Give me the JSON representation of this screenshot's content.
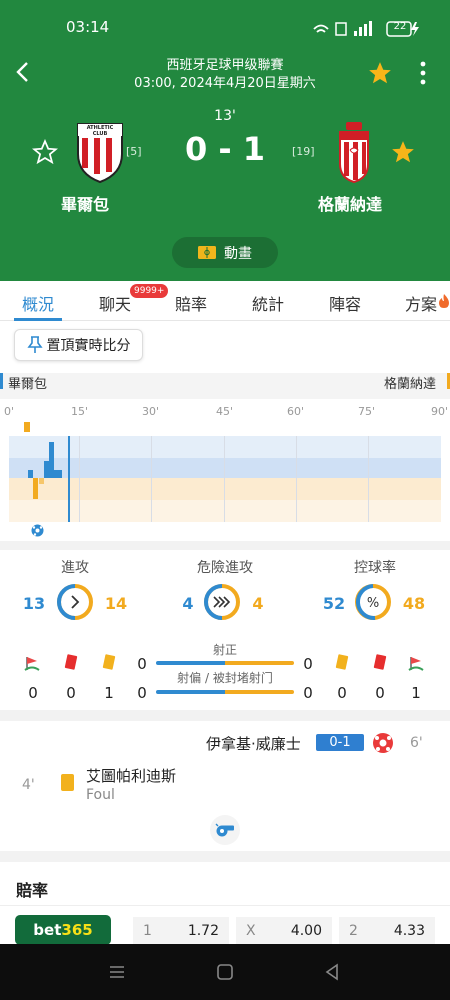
{
  "status_bar": {
    "time": "03:14",
    "battery": "22"
  },
  "header": {
    "league": "西班牙足球甲级聯賽",
    "datetime": "03:00, 2024年4月20日星期六",
    "minute": "13'",
    "score": "0 - 1",
    "home": {
      "name": "畢爾包",
      "rank": "[5]",
      "badge_text": "ATHLETIC CLUB"
    },
    "away": {
      "name": "格蘭納達",
      "rank": "[19]"
    },
    "animation_label": "動畫"
  },
  "tabs": [
    {
      "label": "概況",
      "active": true
    },
    {
      "label": "聊天",
      "badge": "9999+"
    },
    {
      "label": "賠率"
    },
    {
      "label": "統計"
    },
    {
      "label": "陣容"
    },
    {
      "label": "方案"
    }
  ],
  "pin_button": {
    "label": "置頂實時比分"
  },
  "momentum": {
    "home_label": "畢爾包",
    "away_label": "格蘭納達",
    "ticks": [
      "0'",
      "15'",
      "30'",
      "45'",
      "60'",
      "75'",
      "90'"
    ],
    "current_minute": 13
  },
  "stats": {
    "attack": {
      "label": "進攻",
      "home": "13",
      "away": "14"
    },
    "dangerous_attack": {
      "label": "危險進攻",
      "home": "4",
      "away": "4"
    },
    "possession": {
      "label": "控球率",
      "home": "52",
      "away": "48"
    },
    "home_corners": "0",
    "home_red": "0",
    "home_yellow": "1",
    "away_yellow": "0",
    "away_red": "0",
    "away_corners": "1",
    "shots_on_label": "射正",
    "shots_on_home": "0",
    "shots_on_away": "0",
    "shots_off_label": "射偏 / 被封堵射门",
    "shots_off_home": "0",
    "shots_off_away": "0"
  },
  "events": [
    {
      "side": "away",
      "player": "伊拿基·威廉士",
      "score": "0-1",
      "minute": "6'"
    },
    {
      "side": "home",
      "player": "艾圖帕利迪斯",
      "detail": "Foul",
      "minute": "4'"
    }
  ],
  "odds": {
    "title": "賠率",
    "bookmaker": "bet365",
    "bookmaker_part1": "bet",
    "bookmaker_part2": "365",
    "k1": "1",
    "v1": "1.72",
    "kx": "X",
    "vx": "4.00",
    "k2": "2",
    "v2": "4.33"
  },
  "colors": {
    "header_green": "#22883f",
    "home_blue": "#2f8ad0",
    "away_orange": "#f2aa1f",
    "score_chip": "#2f7fd0"
  }
}
